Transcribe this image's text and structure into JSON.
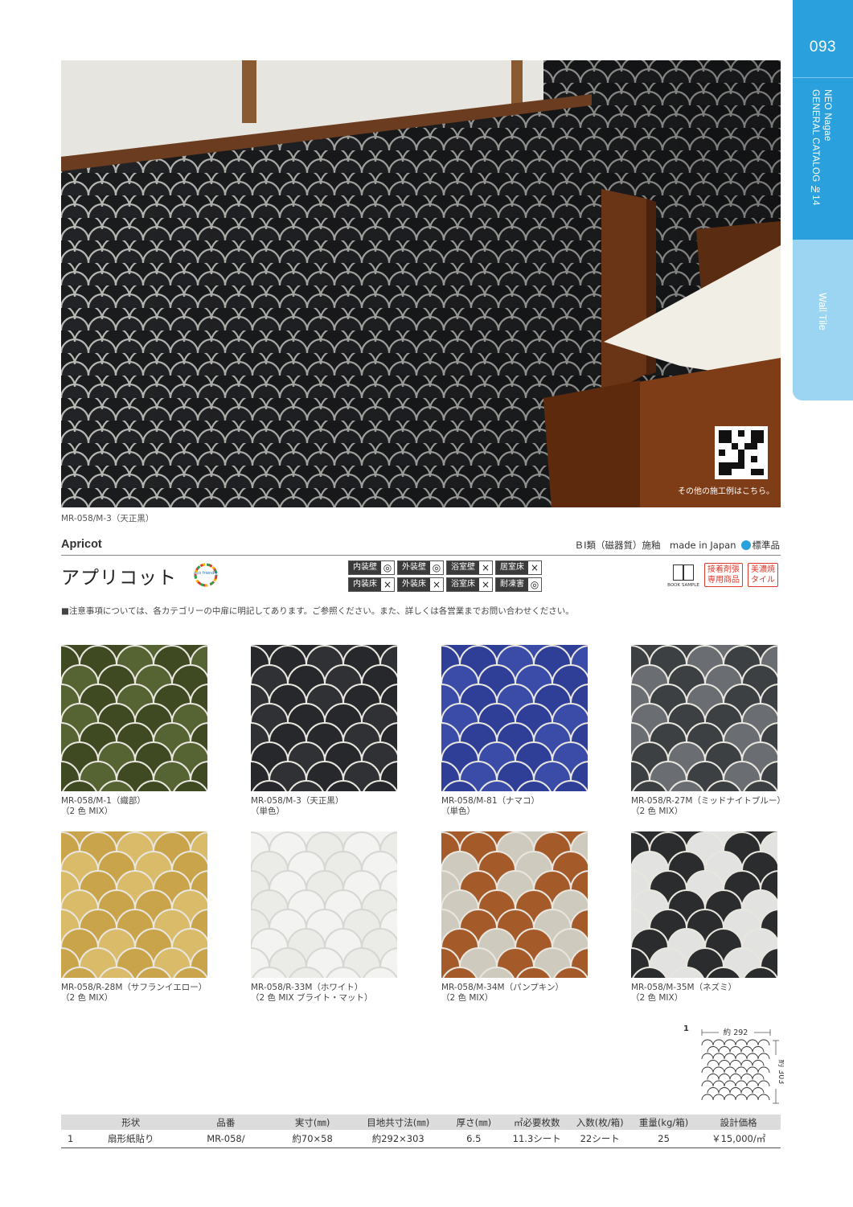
{
  "side_tabs": {
    "page_number": "093",
    "catalog_line1": "NEO Nagae",
    "catalog_line2": "GENERAL CATALOG №14",
    "section": "Wall Tile"
  },
  "hero": {
    "caption": "MR-058/M-3（天正黒）",
    "qr_caption": "その他の施工例はこちら。"
  },
  "product": {
    "name_en": "Apricot",
    "name_jp": "アプリコット",
    "eco_label": "eco friendly",
    "spec": "ＢⅠ類（磁器質）施釉　made in Japan",
    "standard": "標準品",
    "usage": [
      [
        {
          "label": "内装壁",
          "mark": "◎"
        },
        {
          "label": "外装壁",
          "mark": "◎"
        },
        {
          "label": "浴室壁",
          "mark": "×"
        },
        {
          "label": "居室床",
          "mark": "×"
        }
      ],
      [
        {
          "label": "内装床",
          "mark": "×"
        },
        {
          "label": "外装床",
          "mark": "×"
        },
        {
          "label": "浴室床",
          "mark": "×"
        },
        {
          "label": "耐凍害",
          "mark": "◎"
        }
      ]
    ],
    "book_sample": "BOOK SAMPLE",
    "badge1_l1": "接着剤張",
    "badge1_l2": "専用商品",
    "badge2_l1": "美濃焼",
    "badge2_l2": "タイル"
  },
  "notice": "■注意事項については、各カテゴリーの中扉に明記してあります。ご参照ください。また、詳しくは各営業までお問い合わせください。",
  "swatches": [
    {
      "l1": "MR-058/M-1（織部）",
      "l2": "（2 色 MIX）",
      "colors": [
        "#3f4a22",
        "#566333"
      ]
    },
    {
      "l1": "MR-058/M-3（天正黒）",
      "l2": "（単色）",
      "colors": [
        "#26282b",
        "#2f3134"
      ]
    },
    {
      "l1": "MR-058/M-81（ナマコ）",
      "l2": "（単色）",
      "colors": [
        "#2f3f98",
        "#3a4ca8"
      ]
    },
    {
      "l1": "MR-058/R-27M（ミッドナイトブルー）",
      "l2": "（2 色 MIX）",
      "colors": [
        "#3c4043",
        "#6a6e72"
      ]
    },
    {
      "l1": "MR-058/R-28M（サフランイエロー）",
      "l2": "（2 色 MIX）",
      "colors": [
        "#c9a44a",
        "#d9bb6a"
      ]
    },
    {
      "l1": "MR-058/R-33M（ホワイト）",
      "l2": "（2 色 MIX ブライト・マット）",
      "colors": [
        "#f3f3f1",
        "#ebebe8"
      ]
    },
    {
      "l1": "MR-058/M-34M（パンプキン）",
      "l2": "（2 色 MIX）",
      "colors": [
        "#a55a2a",
        "#cfcabe"
      ]
    },
    {
      "l1": "MR-058/M-35M（ネズミ）",
      "l2": "（2 色 MIX）",
      "colors": [
        "#2b2c2e",
        "#e2e2e0"
      ]
    }
  ],
  "diagram": {
    "number": "1",
    "width_label": "約 292",
    "height_label": "約 303"
  },
  "table": {
    "headers": [
      "形状",
      "品番",
      "実寸(㎜)",
      "目地共寸法(㎜)",
      "厚さ(㎜)",
      "㎡必要枚数",
      "入数(枚/箱)",
      "重量(kg/箱)",
      "設計価格"
    ],
    "rows": [
      [
        "1",
        "扇形紙貼り",
        "MR-058/",
        "約70×58",
        "約292×303",
        "6.5",
        "11.3シート",
        "22シート",
        "25",
        "￥15,000/㎡"
      ]
    ]
  }
}
